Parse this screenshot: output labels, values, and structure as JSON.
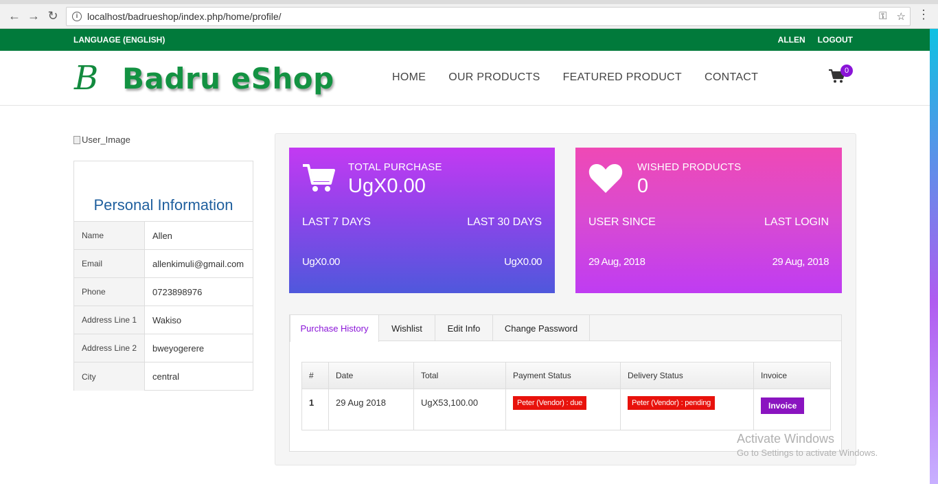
{
  "browser": {
    "url": "localhost/badrueshop/index.php/home/profile/"
  },
  "topbar": {
    "language": "LANGUAGE (ENGLISH)",
    "user": "ALLEN",
    "logout": "LOGOUT"
  },
  "header": {
    "logo_mark": "B",
    "logo_text": "Badru eShop",
    "nav": [
      "HOME",
      "OUR PRODUCTS",
      "FEATURED PRODUCT",
      "CONTACT"
    ],
    "cart_count": "0"
  },
  "profile": {
    "image_alt": "User_Image",
    "title": "Personal Information",
    "rows": [
      {
        "label": "Name",
        "value": "Allen"
      },
      {
        "label": "Email",
        "value": "allenkimuli@gmail.com"
      },
      {
        "label": "Phone",
        "value": "0723898976"
      },
      {
        "label": "Address Line 1",
        "value": "Wakiso"
      },
      {
        "label": "Address Line 2",
        "value": "bweyogerere"
      },
      {
        "label": "City",
        "value": "central"
      }
    ]
  },
  "stats": {
    "purchase": {
      "label": "TOTAL PURCHASE",
      "value": "UgX0.00",
      "left_label": "LAST 7 DAYS",
      "right_label": "LAST 30 DAYS",
      "left_value": "UgX0.00",
      "right_value": "UgX0.00"
    },
    "wish": {
      "label": "WISHED PRODUCTS",
      "value": "0",
      "left_label": "USER SINCE",
      "right_label": "LAST LOGIN",
      "left_value": "29 Aug, 2018",
      "right_value": "29 Aug, 2018"
    }
  },
  "tabs": [
    "Purchase History",
    "Wishlist",
    "Edit Info",
    "Change Password"
  ],
  "history": {
    "headers": [
      "#",
      "Date",
      "Total",
      "Payment Status",
      "Delivery Status",
      "Invoice"
    ],
    "rows": [
      {
        "num": "1",
        "date": "29 Aug 2018",
        "total": "UgX53,100.00",
        "payment": "Peter (Vendor) : due",
        "delivery": "Peter (Vendor) : pending",
        "invoice": "Invoice"
      }
    ]
  },
  "watermark": {
    "line1": "Activate Windows",
    "line2": "Go to Settings to activate Windows."
  },
  "colors": {
    "topbar": "#017a3b",
    "logo": "#139242",
    "accent": "#8a14d8",
    "status_red": "#e8120c"
  }
}
